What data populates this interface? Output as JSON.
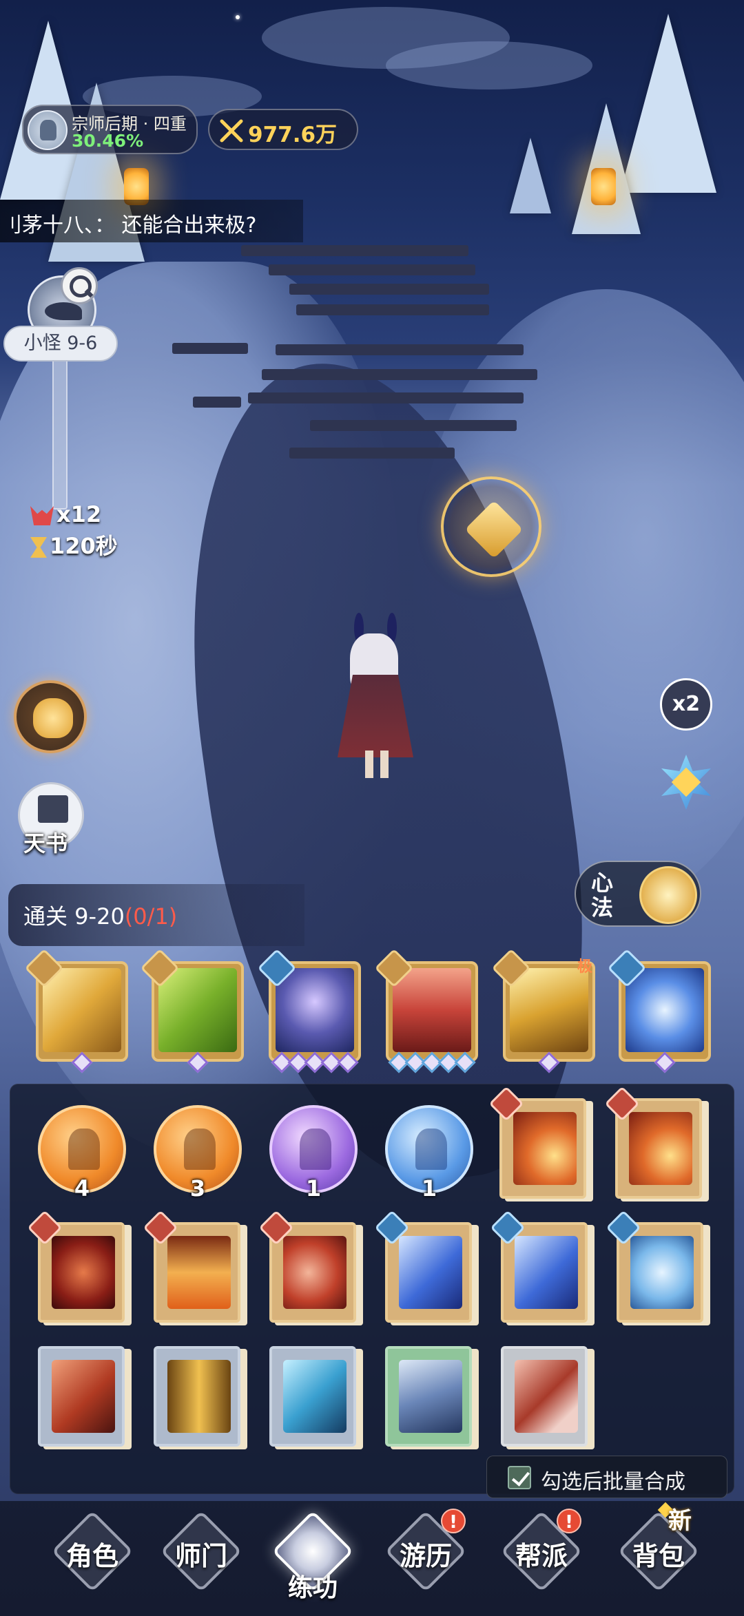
{
  "hud": {
    "rank": {
      "title": "宗师后期 · 四重",
      "progress": "30.46%"
    },
    "power": {
      "value": "977.6万"
    },
    "chat_message": "刂茅十八、： 还能合出来极?",
    "stage": {
      "label": "小怪 9-6"
    },
    "stats": {
      "monsters": "x12",
      "timer": "120秒"
    },
    "speed": "x2",
    "tianshu": "天书",
    "xinfa": "心法",
    "quest": {
      "prefix": "通关 9-20",
      "progress": "(0/1)"
    }
  },
  "skills": {
    "extreme_tag": "极",
    "items": [
      {
        "name": "golden-sword-skill",
        "badge": "sword",
        "pips": 1,
        "pip_color": "purple"
      },
      {
        "name": "green-wind-skill",
        "badge": "sword",
        "pips": 1,
        "pip_color": "purple"
      },
      {
        "name": "arcane-array-skill",
        "badge": "taiji",
        "pips": 5,
        "pip_color": "purple"
      },
      {
        "name": "crimson-blades-skill",
        "badge": "sword",
        "pips": 5,
        "pip_color": "blue"
      },
      {
        "name": "golden-swords-skill",
        "badge": "sword",
        "pips": 1,
        "pip_color": "purple"
      },
      {
        "name": "lightning-palm-skill",
        "badge": "taiji",
        "pips": 1,
        "pip_color": "purple"
      }
    ]
  },
  "inventory": {
    "orbs": [
      {
        "color": "orange",
        "count": "4"
      },
      {
        "color": "orange",
        "count": "3"
      },
      {
        "color": "purple",
        "count": "1"
      },
      {
        "color": "blue",
        "count": "1"
      }
    ],
    "batch_label": "勾选后批量合成"
  },
  "nav": {
    "role": "角色",
    "sect": "师门",
    "training": "练功",
    "travel": "游历",
    "guild": "帮派",
    "bag": "背包",
    "alert": "!",
    "new_tag": "新"
  },
  "colors": {
    "accent_gold": "#ffd35a",
    "progress_green": "#7ef07a",
    "quest_red": "#ff5b4a",
    "alert_red": "#e64a34"
  }
}
